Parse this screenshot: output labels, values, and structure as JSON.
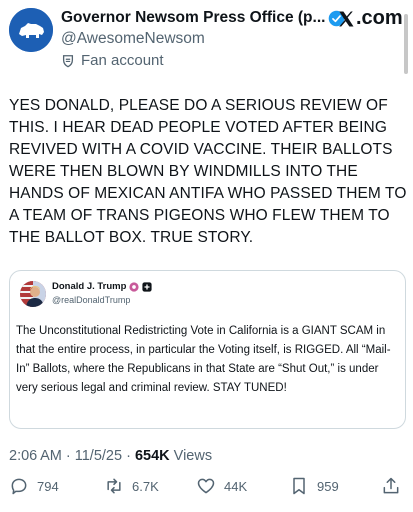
{
  "header": {
    "display_name": "Governor Newsom Press Office (p...",
    "handle": "@AwesomeNewsom",
    "fan_label": "Fan account",
    "site_label": ".com",
    "icons": [
      "bear-avatar-icon",
      "verified-badge-icon",
      "fan-account-icon",
      "x-logo-icon"
    ]
  },
  "tweet": {
    "text": "YES DONALD, PLEASE DO A SERIOUS REVIEW OF THIS. I HEAR DEAD PEOPLE VOTED AFTER BEING REVIVED WITH A COVID VACCINE. THEIR BALLOTS WERE THEN BLOWN BY WINDMILLS INTO THE HANDS OF MEXICAN ANTIFA WHO PASSED THEM TO A TEAM OF TRANS PIGEONS WHO FLEW THEM TO THE BALLOT BOX. TRUE STORY."
  },
  "quote": {
    "name": "Donald J. Trump",
    "handle": "@realDonaldTrump",
    "text": "The Unconstitutional Redistricting Vote in California is a GIANT SCAM in that the entire process, in particular the Voting itself, is RIGGED. All “Mail-In” Ballots, where the Republicans in that State are “Shut Out,” is under very serious legal and criminal review. STAY TUNED!"
  },
  "meta": {
    "time_date": "2:06 AM · 11/5/25 · ",
    "views_count": "654K",
    "views_label": " Views"
  },
  "actions": {
    "replies": "794",
    "reposts": "6.7K",
    "likes": "44K",
    "bookmarks": "959"
  },
  "colors": {
    "text": "#0f1419",
    "secondary": "#536471",
    "verified_blue": "#1d9bf0",
    "avatar_blue": "#1d5fb4",
    "border": "#cfd9de"
  }
}
